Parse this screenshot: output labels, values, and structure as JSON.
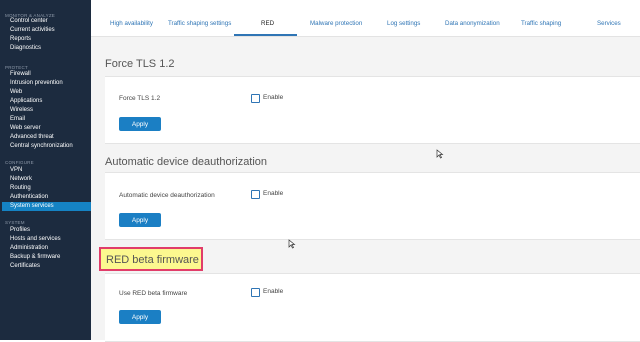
{
  "sidebar": {
    "groups": [
      {
        "header": "MONITOR & ANALYZE",
        "items": [
          "Control center",
          "Current activities",
          "Reports",
          "Diagnostics"
        ]
      },
      {
        "header": "PROTECT",
        "items": [
          "Firewall",
          "Intrusion prevention",
          "Web",
          "Applications",
          "Wireless",
          "Email",
          "Web server",
          "Advanced threat",
          "Central synchronization"
        ]
      },
      {
        "header": "CONFIGURE",
        "items": [
          "VPN",
          "Network",
          "Routing",
          "Authentication",
          "System services"
        ]
      },
      {
        "header": "SYSTEM",
        "items": [
          "Profiles",
          "Hosts and services",
          "Administration",
          "Backup & firmware",
          "Certificates"
        ]
      }
    ],
    "active_item": "System services"
  },
  "tabs": [
    "High availability",
    "Traffic shaping settings",
    "RED",
    "Malware protection",
    "Log settings",
    "Data anonymization",
    "Traffic shaping",
    "Services"
  ],
  "active_tab": "RED",
  "sections": [
    {
      "title": "Force TLS 1.2",
      "row_label": "Force TLS 1.2",
      "checkbox_label": "Enable",
      "checked": false,
      "button": "Apply"
    },
    {
      "title": "Automatic device deauthorization",
      "row_label": "Automatic device deauthorization",
      "checkbox_label": "Enable",
      "checked": false,
      "button": "Apply"
    },
    {
      "title": "RED beta firmware",
      "row_label": "Use RED beta firmware",
      "checkbox_label": "Enable",
      "checked": false,
      "button": "Apply"
    }
  ],
  "colors": {
    "sidebar_bg": "#1c2b3f",
    "accent": "#1b7fc4",
    "highlight_fill": "#fcf88f",
    "highlight_border": "#e13d6a"
  }
}
